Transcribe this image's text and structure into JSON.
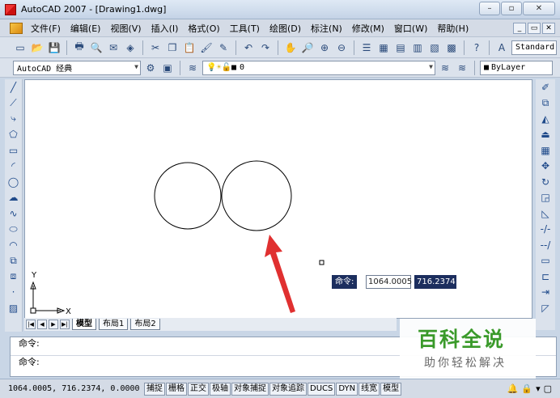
{
  "window": {
    "title": "AutoCAD 2007 - [Drawing1.dwg]"
  },
  "window_controls": {
    "minimize": "–",
    "maximize": "▫",
    "close": "✕"
  },
  "doc_controls": {
    "minimize": "_",
    "restore": "▭",
    "close": "✕"
  },
  "menu": [
    "文件(F)",
    "编辑(E)",
    "视图(V)",
    "插入(I)",
    "格式(O)",
    "工具(T)",
    "绘图(D)",
    "标注(N)",
    "修改(M)",
    "窗口(W)",
    "帮助(H)"
  ],
  "toolbar": {
    "text_style": "Standard"
  },
  "workspace": {
    "name": "AutoCAD 经典"
  },
  "layer": {
    "current": "0"
  },
  "properties": {
    "color": "ByLayer"
  },
  "ucs": {
    "y_label": "Y",
    "x_label": "X"
  },
  "tabs": [
    "模型",
    "布局1",
    "布局2"
  ],
  "dynamic_input": {
    "label": "命令:",
    "x": "1064.0005",
    "y": "716.2374"
  },
  "command_window": {
    "line1": "命令:",
    "line2": "命令:"
  },
  "status": {
    "coords": "1064.0005, 716.2374, 0.0000",
    "buttons": [
      "捕捉",
      "栅格",
      "正交",
      "极轴",
      "对象捕捉",
      "对象追踪",
      "DUCS",
      "DYN",
      "线宽",
      "模型"
    ]
  },
  "watermark": {
    "title": "百科全说",
    "subtitle": "助你轻松解决"
  }
}
